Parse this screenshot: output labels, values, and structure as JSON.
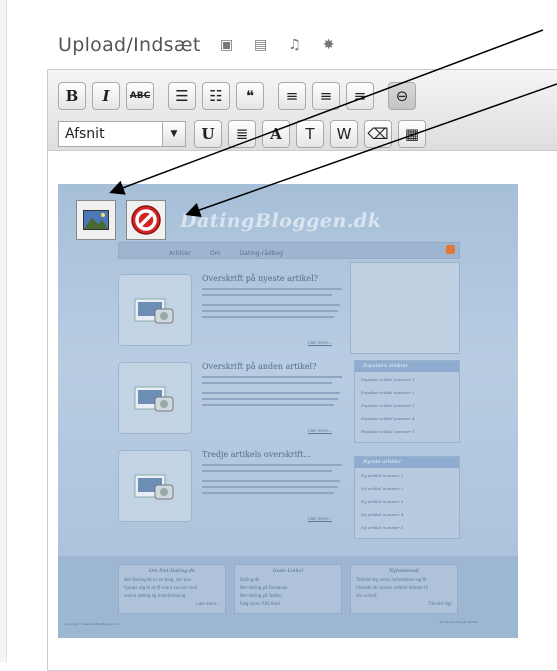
{
  "header": {
    "title": "Upload/Indsæt"
  },
  "upload_icons": [
    "image-icon",
    "video-icon",
    "audio-icon",
    "media-icon"
  ],
  "toolbar": {
    "row1": [
      {
        "name": "bold-button",
        "label": "B",
        "cls": "bold"
      },
      {
        "name": "italic-button",
        "label": "I",
        "cls": "ital"
      },
      {
        "name": "strikethrough-button",
        "label": "ABC",
        "cls": "abc"
      },
      {
        "name": "bullet-list-button",
        "label": "☰",
        "cls": ""
      },
      {
        "name": "numbered-list-button",
        "label": "☷",
        "cls": ""
      },
      {
        "name": "blockquote-button",
        "label": "❝",
        "cls": ""
      },
      {
        "name": "align-left-button",
        "label": "≡",
        "cls": ""
      },
      {
        "name": "align-center-button",
        "label": "≡",
        "cls": ""
      },
      {
        "name": "align-right-button",
        "label": "≡",
        "cls": ""
      },
      {
        "name": "link-button",
        "label": "⊖",
        "cls": "active"
      }
    ],
    "format_value": "Afsnit",
    "row2": [
      {
        "name": "underline-button",
        "label": "U",
        "cls": "bold"
      },
      {
        "name": "justify-button",
        "label": "≣",
        "cls": ""
      },
      {
        "name": "text-color-button",
        "label": "A",
        "cls": "bold"
      },
      {
        "name": "paste-text-button",
        "label": "T",
        "cls": ""
      },
      {
        "name": "paste-word-button",
        "label": "W",
        "cls": ""
      },
      {
        "name": "remove-format-button",
        "label": "⌫",
        "cls": ""
      },
      {
        "name": "insert-media-button",
        "label": "▦",
        "cls": ""
      }
    ]
  },
  "content": {
    "blog_title": "DatingBloggen.dk",
    "nav_items": [
      "Artikler",
      "Om",
      "Dating-rådbog"
    ],
    "posts": [
      {
        "title": "Overskrift på nyeste artikel?"
      },
      {
        "title": "Overskrift på anden artikel?"
      },
      {
        "title": "Tredje artikels overskrift..."
      }
    ],
    "more_label": "Læs mere...",
    "widgets": [
      {
        "title": "Populære artikler",
        "items": [
          "Populær artikel nummer 1",
          "Populær artikel nummer 2",
          "Populær artikel nummer 3",
          "Populær artikel nummer 4",
          "Populær artikel nummer 5"
        ]
      },
      {
        "title": "Nyeste artikler",
        "items": [
          "Ny artikel nummer 1",
          "Ny artikel nummer 2",
          "Ny artikel nummer 3",
          "Ny artikel nummer 4",
          "Ny artikel nummer 5"
        ]
      }
    ],
    "footer": [
      {
        "title": "Om Net-Dating.dk",
        "lines": [
          "Net-Dating.dk er en blog, der kan",
          "hjælpe dig til at få mere succes med",
          "online dating og matchmaking.",
          "Læs mere..."
        ]
      },
      {
        "title": "Gode Links!",
        "lines": [
          "Dating.dk",
          "Net-dating på Facebook",
          "Net-dating på Twitter",
          "Følg vores RSS feed"
        ]
      },
      {
        "title": "Nyhedsmail",
        "lines": [
          "Tilmeld dig vores nyhedsbrev og få",
          "tilsendt de nyeste artikler direkte til",
          "din e-mail:",
          "Tilmeld dig!"
        ]
      }
    ],
    "copyright": "Copyright © www.DatingBloggen.dk",
    "credit": "Wordpress blog af WPF.dk"
  },
  "colors": {
    "arrow": "#000000",
    "content_bg": "#a6bfd8",
    "cancel_red": "#d42525"
  }
}
